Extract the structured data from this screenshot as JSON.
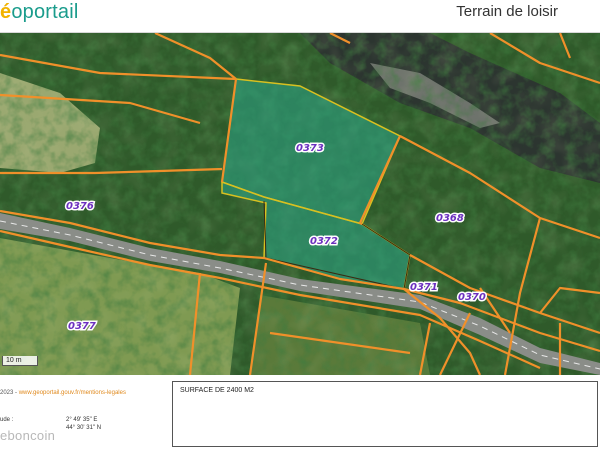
{
  "header": {
    "logo_mark": "é",
    "logo_text": "oportail",
    "title": "Terrain de loisir"
  },
  "map": {
    "parcels": [
      {
        "id": "0373"
      },
      {
        "id": "0372"
      },
      {
        "id": "0376"
      },
      {
        "id": "0368"
      },
      {
        "id": "0371"
      },
      {
        "id": "0370"
      },
      {
        "id": "0377"
      }
    ],
    "scale_label": "10 m",
    "colors": {
      "cadastre_line": "#f0902a",
      "selection_fill": "#2ca88a",
      "selection_stroke": "#d8c020",
      "parcel_label": "#6b2fbf"
    }
  },
  "footer": {
    "copyright_prefix": "2023 - ",
    "copyright_link": "www.geoportail.gouv.fr/mentions-legales",
    "lon_label": "ude :",
    "lon_value": "2° 49' 35\" E",
    "lat_label": "",
    "lat_value": "44° 30' 31\" N",
    "watermark": "eboncoin",
    "surface": "SURFACE DE 2400 M2"
  }
}
